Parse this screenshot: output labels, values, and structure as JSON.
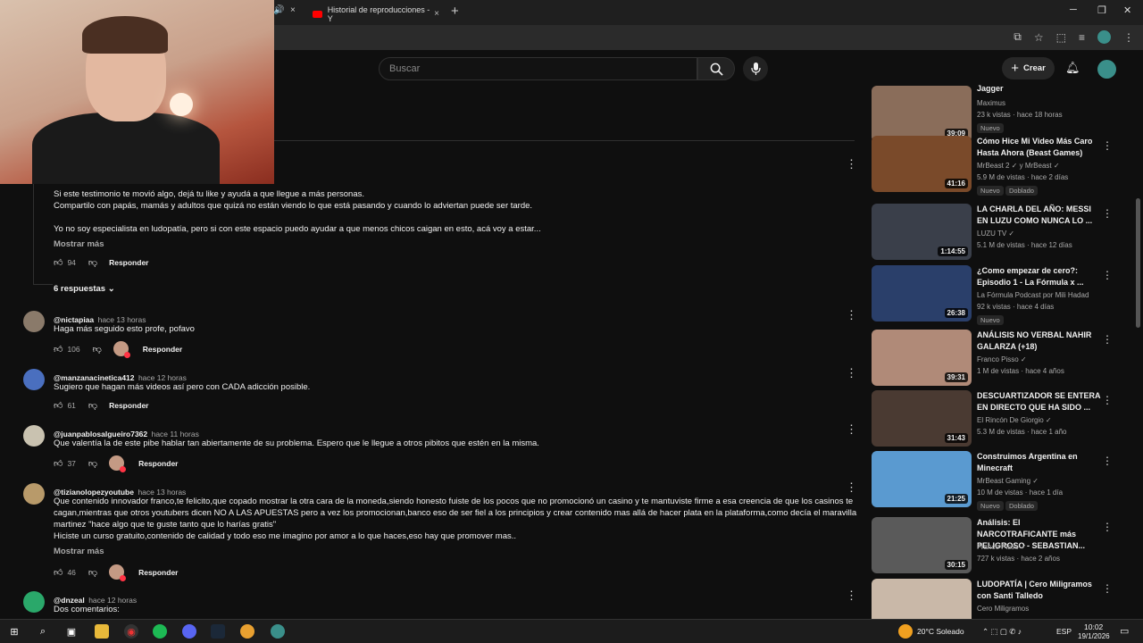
{
  "browser": {
    "tab_title": "Historial de reproducciones - Y",
    "new_tab": "+",
    "tab_close": "×",
    "prev_tab_icon": "🔊",
    "window_minimize": "─",
    "window_restore": "❐",
    "window_close": "✕"
  },
  "header": {
    "search_placeholder": "Buscar",
    "create_label": "Crear",
    "create_plus": "+"
  },
  "pinned_comment": {
    "line1": "Si este testimonio te movió algo, dejá tu like y ayudá a que llegue a más personas.",
    "line2": "Compartilo con papás, mamás y adultos que quizá no están viendo lo que está pasando y cuando lo adviertan puede ser tarde.",
    "line3": "Yo no soy especialista en ludopatía, pero si con este espacio puedo ayudar a que menos chicos caigan en esto, acá voy a estar...",
    "show_more": "Mostrar más",
    "likes": "94",
    "reply": "Responder",
    "replies_label": "6 respuestas"
  },
  "comments": [
    {
      "author": "@nictapiaa",
      "time": "hace 13 horas",
      "text": "Haga más seguido esto profe, pofavo",
      "likes": "106",
      "reply": "Responder"
    },
    {
      "author": "@manzanacinetica412",
      "time": "hace 12 horas",
      "text": "Sugiero que hagan más videos así pero con CADA adicción posible.",
      "likes": "61",
      "reply": "Responder"
    },
    {
      "author": "@juanpablosalgueiro7362",
      "time": "hace 11 horas",
      "text": "Que valentía la de este pibe hablar tan abiertamente de su problema. Espero que le llegue a otros pibitos que estén en la misma.",
      "likes": "37",
      "reply": "Responder"
    },
    {
      "author": "@tizianolopezyoutube",
      "time": "hace 13 horas",
      "text1": "Que contenido innovador franco,te felicito,que copado mostrar la otra cara de la moneda,siendo honesto fuiste de los pocos que no promocionó un casino y te mantuviste firme a esa creencia de que los casinos te",
      "text2": "cagan,mientras que otros youtubers dicen NO A LAS APUESTAS pero a vez los promocionan,banco eso de ser fiel a los principios y crear contenido mas allá de hacer plata en la plataforma,como decía el maravilla",
      "text3": "martinez \"hace algo que te guste tanto que lo harías gratis\"",
      "text4": "Hiciste un curso gratuito,contenido de calidad y todo eso me imagino por amor a lo que haces,eso hay que promover mas..",
      "show_more": "Mostrar más",
      "likes": "46",
      "reply": "Responder"
    },
    {
      "author": "@dnzeal",
      "time": "hace 12 horas",
      "text": "Dos comentarios:"
    }
  ],
  "sidebar": [
    {
      "title": "Jagger",
      "channel": "Maximus",
      "meta": "23 k vistas · hace 18 horas",
      "duration": "39:09",
      "badge": "Nuevo",
      "color": "#8a6d5a"
    },
    {
      "title": "Cómo Hice Mi Video Más Caro Hasta Ahora (Beast Games)",
      "channel": "MrBeast 2 ✓ y MrBeast ✓",
      "meta": "5.9 M de vistas · hace 2 días",
      "duration": "41:16",
      "badge": "Nuevo",
      "badge2": "Doblado",
      "color": "#7a4a2a"
    },
    {
      "title": "LA CHARLA DEL AÑO: MESSI EN LUZU COMO NUNCA LO ...",
      "channel": "LUZU TV ✓",
      "meta": "5.1 M de vistas · hace 12 días",
      "duration": "1:14:55",
      "color": "#3a3f4a"
    },
    {
      "title": "¿Como empezar de cero?: Episodio 1 - La Fórmula x ...",
      "channel": "La Fórmula Podcast por Mili Hadad",
      "meta": "92 k vistas · hace 4 días",
      "duration": "26:38",
      "badge": "Nuevo",
      "color": "#2a3f6a"
    },
    {
      "title": "ANÁLISIS NO VERBAL NAHIR GALARZA (+18)",
      "channel": "Franco Pisso ✓",
      "meta": "1 M de vistas · hace 4 años",
      "duration": "39:31",
      "color": "#b08a78"
    },
    {
      "title": "DESCUARTIZADOR SE ENTERA EN DIRECTO QUE HA SIDO ...",
      "channel": "El Rincón De Giorgio ✓",
      "meta": "5.3 M de vistas · hace 1 año",
      "duration": "31:43",
      "color": "#4a3a32"
    },
    {
      "title": "Construimos Argentina en Minecraft",
      "channel": "MrBeast Gaming ✓",
      "meta": "10 M de vistas · hace 1 día",
      "duration": "21:25",
      "badge": "Nuevo",
      "badge2": "Doblado",
      "color": "#5a9ad0"
    },
    {
      "title": "Análisis: El NARCOTRAFICANTE más PELIGROSO - SEBASTIAN...",
      "channel": "Franco Pisso ✓",
      "meta": "727 k vistas · hace 2 años",
      "duration": "30:15",
      "color": "#5a5a5a"
    },
    {
      "title": "LUDOPATÍA | Cero Miligramos con Santi Talledo",
      "channel": "Cero Miligramos",
      "meta": "",
      "duration": "",
      "color": "#c9b8a8"
    }
  ],
  "taskbar": {
    "weather": "20°C  Soleado",
    "lang": "ESP",
    "time": "10:02",
    "date": "19/1/2026"
  },
  "colors": {
    "accent_red": "#ff0000",
    "bg": "#0f0f0f"
  }
}
